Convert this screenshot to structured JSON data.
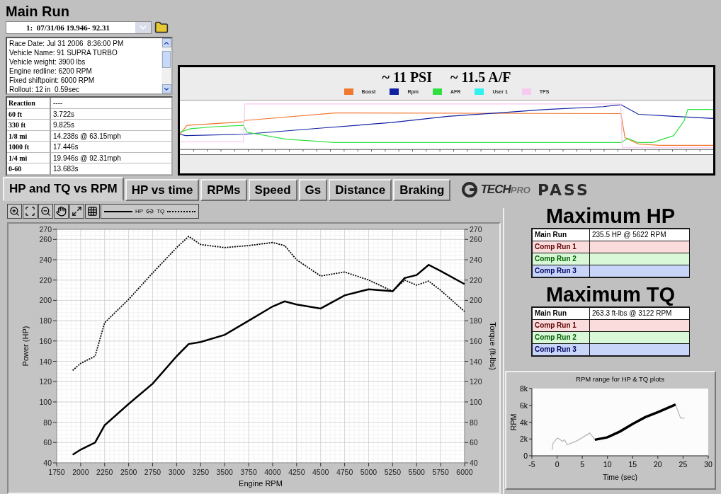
{
  "title": "Main Run",
  "run_selector": {
    "value": "1:  07/31/06 19.946- 92.31"
  },
  "run_info": [
    "Race Date: Jul 31 2006  8:36:00 PM",
    "Vehicle Name: 91 SUPRA TURBO",
    "Vehicle weight: 3900 lbs",
    "Engine redline: 6200 RPM",
    "Fixed shiftpoint: 6000 RPM",
    "Rollout: 12 in  0.59sec"
  ],
  "splits": [
    {
      "label": "Reaction",
      "value": "----"
    },
    {
      "label": "60 ft",
      "value": "3.722s"
    },
    {
      "label": "330 ft",
      "value": "9.825s"
    },
    {
      "label": "1/8 mi",
      "value": "14.238s @ 63.15mph"
    },
    {
      "label": "1000 ft",
      "value": "17.446s"
    },
    {
      "label": "1/4 mi",
      "value": "19.946s @ 92.31mph"
    },
    {
      "label": "0-60",
      "value": "13.683s"
    }
  ],
  "log_graph": {
    "title_parts": [
      "~ 11 PSI",
      "~ 11.5 A/F"
    ],
    "legend": [
      {
        "label": "Boost",
        "color": "#f07830"
      },
      {
        "label": "Rpm",
        "color": "#1020a0"
      },
      {
        "label": "AFR",
        "color": "#30e040"
      },
      {
        "label": "User 1",
        "color": "#30f0f0"
      },
      {
        "label": "TPS",
        "color": "#f8c8f0"
      }
    ]
  },
  "tabs": [
    {
      "label": "HP and TQ vs RPM",
      "selected": true
    },
    {
      "label": "HP vs time",
      "selected": false
    },
    {
      "label": "RPMs",
      "selected": false
    },
    {
      "label": "Speed",
      "selected": false
    },
    {
      "label": "Gs",
      "selected": false
    },
    {
      "label": "Distance",
      "selected": false
    },
    {
      "label": "Braking",
      "selected": false
    }
  ],
  "logo": {
    "brand": "TECH",
    "suffix": "PRO",
    "product": "PASS"
  },
  "power_chart": {
    "chart_data": {
      "type": "line",
      "xlabel": "Engine RPM",
      "ylabel": "Power (HP)",
      "y2label": "Torque (ft-lbs)",
      "x": [
        1917,
        2000,
        2150,
        2250,
        2500,
        2750,
        3000,
        3125,
        3250,
        3500,
        3750,
        4000,
        4125,
        4250,
        4500,
        4750,
        5000,
        5250,
        5375,
        5500,
        5625,
        5750,
        6000
      ],
      "series": [
        {
          "name": "HP",
          "color": "#000000",
          "line_style": "solid",
          "values": [
            48,
            53,
            60,
            77,
            98,
            118,
            145,
            157,
            159,
            166,
            180,
            194,
            199,
            196,
            192,
            205,
            211,
            209,
            222,
            225,
            235,
            229,
            216
          ]
        },
        {
          "name": "TQ",
          "color": "#000000",
          "line_style": "dashed",
          "values": [
            131,
            138,
            145,
            178,
            201,
            227,
            252,
            263,
            255,
            252,
            254,
            257,
            254,
            240,
            224,
            228,
            220,
            209,
            220,
            215,
            219,
            210,
            189
          ]
        }
      ],
      "xlim": [
        1750,
        6000
      ],
      "ylim": [
        40,
        270
      ],
      "xticks": [
        1750,
        2000,
        2250,
        2500,
        2750,
        3000,
        3250,
        3500,
        3750,
        4000,
        4250,
        4500,
        4750,
        5000,
        5250,
        5500,
        5750,
        6000
      ],
      "yticks": [
        40,
        60,
        80,
        100,
        120,
        140,
        160,
        180,
        200,
        220,
        240,
        260,
        270
      ],
      "y2lim": [
        40,
        270
      ],
      "y2ticks": [
        40,
        60,
        80,
        100,
        120,
        140,
        160,
        180,
        200,
        220,
        240,
        260,
        270
      ],
      "grid": true
    }
  },
  "max_hp": {
    "title": "Maximum HP",
    "rows": [
      {
        "label": "Main Run",
        "value": "235.5 HP @ 5622 RPM",
        "color": "#ffffff"
      },
      {
        "label": "Comp Run 1",
        "color": "#fadcdc"
      },
      {
        "label": "Comp Run 2",
        "color": "#d8f8d8"
      },
      {
        "label": "Comp Run 3",
        "color": "#c8d4f8"
      }
    ]
  },
  "max_tq": {
    "title": "Maximum TQ",
    "rows": [
      {
        "label": "Main Run",
        "value": "263.3 ft-lbs @ 3122 RPM",
        "color": "#ffffff"
      },
      {
        "label": "Comp Run 1",
        "color": "#fadcdc"
      },
      {
        "label": "Comp Run 2",
        "color": "#d8f8d8"
      },
      {
        "label": "Comp Run 3",
        "color": "#c8d4f8"
      }
    ]
  },
  "rpm_chart": {
    "chart_data": {
      "type": "line",
      "title": "RPM range for HP & TQ plots",
      "xlabel": "Time (sec)",
      "ylabel": "RPM",
      "x": [
        -1,
        -0.8,
        0,
        0.5,
        1,
        1.5,
        2,
        4,
        6.5,
        7.5,
        10,
        12.5,
        15,
        17.5,
        20,
        23.5,
        24.5,
        25.3
      ],
      "series": [
        {
          "color": "#b4b4b4",
          "values": [
            700,
            1500,
            2100,
            2000,
            1700,
            1900,
            1300,
            1800,
            2700,
            1900,
            2200,
            2900,
            3800,
            4600,
            5200,
            6100,
            4500,
            4500
          ]
        },
        {
          "color": "#000000",
          "values": [
            null,
            null,
            null,
            null,
            null,
            null,
            null,
            null,
            null,
            1900,
            2200,
            2900,
            3800,
            4600,
            5200,
            6100,
            null,
            null
          ]
        }
      ],
      "xlim": [
        -5,
        30
      ],
      "ylim": [
        0,
        8000
      ],
      "xticks": [
        -5,
        0,
        5,
        10,
        15,
        20,
        25,
        30
      ],
      "yticks": [
        {
          "value": 0,
          "label": "0"
        },
        {
          "value": 2000,
          "label": "2k"
        },
        {
          "value": 4000,
          "label": "4k"
        },
        {
          "value": 6000,
          "label": "6k"
        },
        {
          "value": 8000,
          "label": "8k"
        }
      ]
    }
  }
}
